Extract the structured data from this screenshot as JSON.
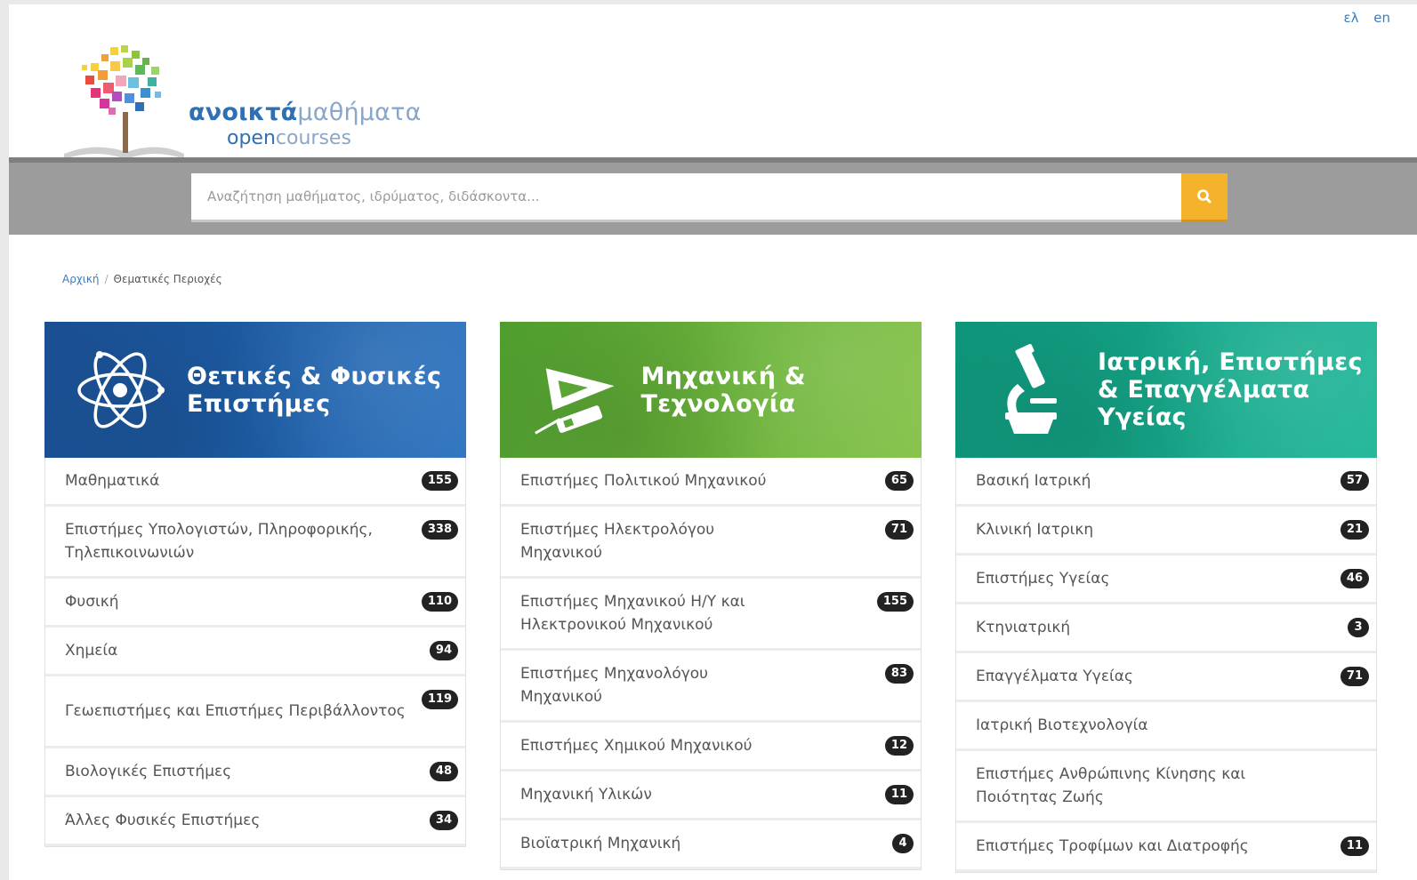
{
  "lang": {
    "el": "ελ",
    "en": "en"
  },
  "logo": {
    "line1_bold": "ανοικτά",
    "line1_light": "μαθήματα",
    "line2_bold": "open",
    "line2_light": "courses"
  },
  "search": {
    "placeholder": "Αναζήτηση μαθήματος, ιδρύματος, διδάσκοντα..."
  },
  "breadcrumb": {
    "home": "Αρχική",
    "separator": "/",
    "current": "Θεματικές Περιοχές"
  },
  "colors": {
    "blue": "#1d5ea8",
    "green": "#6bb33b",
    "teal": "#16a88a",
    "search_button": "#f4b32a"
  },
  "columns": [
    {
      "title": "Θετικές & Φυσικές Επιστήμες",
      "icon": "atom-icon",
      "items": [
        {
          "label": "Μαθηματικά",
          "count": "155"
        },
        {
          "label": "Επιστήμες Υπολογιστών, Πληροφορικής, Τηλεπικοινωνιών",
          "count": "338"
        },
        {
          "label": "Φυσική",
          "count": "110"
        },
        {
          "label": "Χημεία",
          "count": "94"
        },
        {
          "label": "Γεωεπιστήμες και Επιστήμες Περιβάλλοντος",
          "count": "119"
        },
        {
          "label": "Βιολογικές Επιστήμες",
          "count": "48"
        },
        {
          "label": "Άλλες Φυσικές Επιστήμες",
          "count": "34"
        }
      ]
    },
    {
      "title": "Μηχανική & Τεχνολογία",
      "icon": "drafting-triangle-icon",
      "items": [
        {
          "label": "Επιστήμες Πολιτικού Μηχανικού",
          "count": "65"
        },
        {
          "label": "Επιστήμες Ηλεκτρολόγου Μηχανικού",
          "count": "71"
        },
        {
          "label": "Επιστήμες Μηχανικού Η/Υ και Ηλεκτρονικού Μηχανικού",
          "count": "155"
        },
        {
          "label": "Επιστήμες Μηχανολόγου Μηχανικού",
          "count": "83"
        },
        {
          "label": "Επιστήμες Χημικού Μηχανικού",
          "count": "12"
        },
        {
          "label": "Μηχανική Υλικών",
          "count": "11"
        },
        {
          "label": "Βιοϊατρική Μηχανική",
          "count": "4"
        }
      ]
    },
    {
      "title": "Ιατρική, Επιστήμες & Επαγγέλματα Υγείας",
      "icon": "microscope-icon",
      "items": [
        {
          "label": "Βασική Ιατρική",
          "count": "57"
        },
        {
          "label": "Κλινική Ιατρικη",
          "count": "21"
        },
        {
          "label": "Επιστήμες Υγείας",
          "count": "46"
        },
        {
          "label": "Κτηνιατρική",
          "count": "3"
        },
        {
          "label": "Επαγγέλματα Υγείας",
          "count": "71"
        },
        {
          "label": "Ιατρική Βιοτεχνολογία",
          "count": ""
        },
        {
          "label": "Επιστήμες Ανθρώπινης Κίνησης και Ποιότητας Ζωής",
          "count": ""
        },
        {
          "label": "Επιστήμες Τροφίμων και Διατροφής",
          "count": "11"
        }
      ]
    }
  ]
}
